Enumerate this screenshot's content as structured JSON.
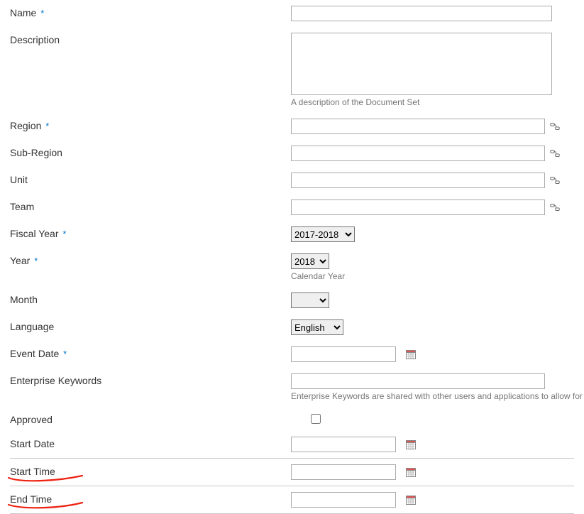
{
  "labels": {
    "name": "Name",
    "description": "Description",
    "region": "Region",
    "subregion": "Sub-Region",
    "unit": "Unit",
    "team": "Team",
    "fiscal_year": "Fiscal Year",
    "year": "Year",
    "month": "Month",
    "language": "Language",
    "event_date": "Event Date",
    "enterprise_keywords": "Enterprise Keywords",
    "approved": "Approved",
    "start_date": "Start Date",
    "start_time": "Start Time",
    "end_time": "End Time"
  },
  "required_marker": "*",
  "helpers": {
    "description": "A description of the Document Set",
    "year": "Calendar Year",
    "enterprise_keywords": "Enterprise Keywords are shared with other users and applications to allow for ease of"
  },
  "values": {
    "name": "",
    "description": "",
    "region": "",
    "subregion": "",
    "unit": "",
    "team": "",
    "fiscal_year": "2017-2018",
    "year": "2018",
    "month": "",
    "language": "English",
    "event_date": "",
    "enterprise_keywords": "",
    "approved": false,
    "start_date": "",
    "start_time": "",
    "end_time": ""
  },
  "options": {
    "fiscal_year": [
      "2017-2018"
    ],
    "year": [
      "2018"
    ],
    "month": [
      ""
    ],
    "language": [
      "English"
    ]
  }
}
